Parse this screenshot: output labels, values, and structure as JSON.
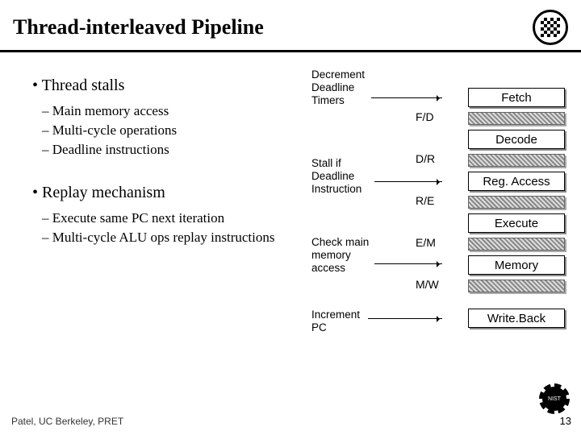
{
  "title": "Thread-interleaved Pipeline",
  "left": {
    "section1": {
      "heading": "Thread stalls",
      "items": [
        "Main memory access",
        "Multi-cycle operations",
        "Deadline instructions"
      ]
    },
    "section2": {
      "heading": "Replay mechanism",
      "items": [
        "Execute same PC next iteration",
        "Multi-cycle ALU ops replay instructions"
      ]
    }
  },
  "pipeline": {
    "stages": [
      "Fetch",
      "Decode",
      "Reg. Access",
      "Execute",
      "Memory",
      "Write.Back"
    ],
    "buffers": [
      "F/D",
      "D/R",
      "R/E",
      "E/M",
      "M/W"
    ],
    "annotations": {
      "decrement": "Decrement\nDeadline\nTimers",
      "stall": "Stall if\nDeadline\nInstruction",
      "check": "Check main\nmemory\naccess",
      "increment": "Increment\nPC"
    }
  },
  "footer": {
    "left": "Patel, UC Berkeley, PRET",
    "right": "13"
  },
  "gear_label": "NIST"
}
